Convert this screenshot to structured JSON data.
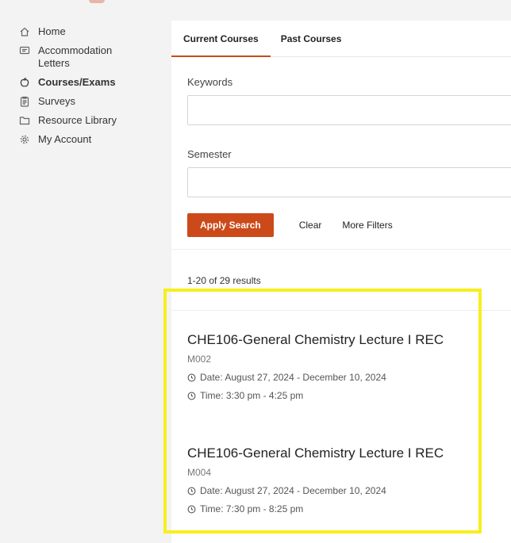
{
  "sidebar": {
    "items": [
      {
        "label": "Home",
        "icon": "home-icon"
      },
      {
        "label": "Accommodation Letters",
        "icon": "letter-icon"
      },
      {
        "label": "Courses/Exams",
        "icon": "apple-icon"
      },
      {
        "label": "Surveys",
        "icon": "clipboard-icon"
      },
      {
        "label": "Resource Library",
        "icon": "folder-icon"
      },
      {
        "label": "My Account",
        "icon": "gear-icon"
      }
    ]
  },
  "tabs": [
    {
      "label": "Current Courses"
    },
    {
      "label": "Past Courses"
    }
  ],
  "filters": {
    "keywords_label": "Keywords",
    "keywords_value": "",
    "semester_label": "Semester",
    "semester_value": "",
    "apply_label": "Apply Search",
    "clear_label": "Clear",
    "more_label": "More Filters"
  },
  "results": {
    "count_text": "1-20 of 29 results"
  },
  "courses": [
    {
      "title": "CHE106-General Chemistry Lecture I REC",
      "code": "M002",
      "date": "Date: August 27, 2024 - December 10, 2024",
      "time": "Time: 3:30 pm - 4:25 pm"
    },
    {
      "title": "CHE106-General Chemistry Lecture I REC",
      "code": "M004",
      "date": "Date: August 27, 2024 - December 10, 2024",
      "time": "Time: 7:30 pm - 8:25 pm"
    }
  ],
  "colors": {
    "accent": "#cc4a1a",
    "highlight": "#f7ef1c"
  }
}
